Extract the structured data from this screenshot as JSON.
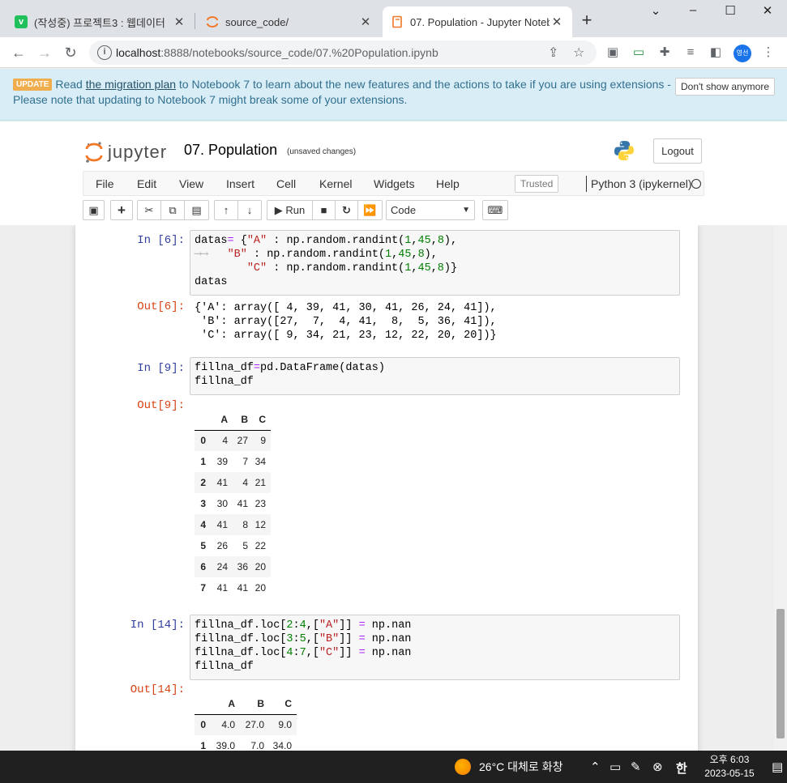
{
  "browser": {
    "tabs": [
      {
        "title": "(작성중) 프로젝트3 : 웹데이터",
        "favicon": "v-favicon",
        "favicon_glyph": "v",
        "favicon_color": "#20c05c"
      },
      {
        "title": "source_code/",
        "favicon": "jupyter-favicon",
        "favicon_glyph": "",
        "favicon_color": "#f37726"
      },
      {
        "title": "07. Population - Jupyter Notebook",
        "favicon": "notebook-favicon",
        "favicon_glyph": "",
        "favicon_color": "#f37726"
      }
    ],
    "new_tab_glyph": "+",
    "window_controls": [
      "⌄",
      "–",
      "☐",
      "✕"
    ],
    "url_host": "localhost",
    "url_path": ":8888/notebooks/source_code/07.%20Population.ipynb",
    "profile_label": "영선"
  },
  "banner": {
    "badge": "UPDATE",
    "text_before": "Read ",
    "link": "the migration plan",
    "text_after": " to Notebook 7 to learn about the new features and the actions to take if you are using extensions - Please note that updating to Notebook 7 might break some of your extensions.",
    "dismiss": "Don't show anymore"
  },
  "header": {
    "logo_text": "jupyter",
    "notebook_title": "07. Population",
    "autosave": "(unsaved changes)",
    "logout": "Logout"
  },
  "menu": {
    "items": [
      "File",
      "Edit",
      "View",
      "Insert",
      "Cell",
      "Kernel",
      "Widgets",
      "Help"
    ],
    "trusted": "Trusted",
    "kernel": "Python 3 (ipykernel)"
  },
  "toolbar": {
    "run": "Run",
    "cell_type": "Code"
  },
  "cells": {
    "c1": {
      "in_prompt": "In [6]:",
      "out_prompt": "Out[6]:",
      "out_lines": [
        "{'A': array([ 4, 39, 41, 30, 41, 26, 24, 41]),",
        " 'B': array([27,  7,  4, 41,  8,  5, 36, 41]),",
        " 'C': array([ 9, 34, 21, 23, 12, 22, 20, 20])}"
      ]
    },
    "c2": {
      "in_prompt": "In [9]:",
      "out_prompt": "Out[9]:",
      "columns": [
        "A",
        "B",
        "C"
      ],
      "rows": [
        {
          "idx": "0",
          "vals": [
            "4",
            "27",
            "9"
          ]
        },
        {
          "idx": "1",
          "vals": [
            "39",
            "7",
            "34"
          ]
        },
        {
          "idx": "2",
          "vals": [
            "41",
            "4",
            "21"
          ]
        },
        {
          "idx": "3",
          "vals": [
            "30",
            "41",
            "23"
          ]
        },
        {
          "idx": "4",
          "vals": [
            "41",
            "8",
            "12"
          ]
        },
        {
          "idx": "5",
          "vals": [
            "26",
            "5",
            "22"
          ]
        },
        {
          "idx": "6",
          "vals": [
            "24",
            "36",
            "20"
          ]
        },
        {
          "idx": "7",
          "vals": [
            "41",
            "41",
            "20"
          ]
        }
      ]
    },
    "c3": {
      "in_prompt": "In [14]:",
      "out_prompt": "Out[14]:",
      "columns": [
        "A",
        "B",
        "C"
      ],
      "rows": [
        {
          "idx": "0",
          "vals": [
            "4.0",
            "27.0",
            "9.0"
          ]
        },
        {
          "idx": "1",
          "vals": [
            "39.0",
            "7.0",
            "34.0"
          ]
        }
      ]
    }
  },
  "taskbar": {
    "weather": "26°C  대체로 화창",
    "ime": "한",
    "time": "오후 6:03",
    "date": "2023-05-15"
  }
}
